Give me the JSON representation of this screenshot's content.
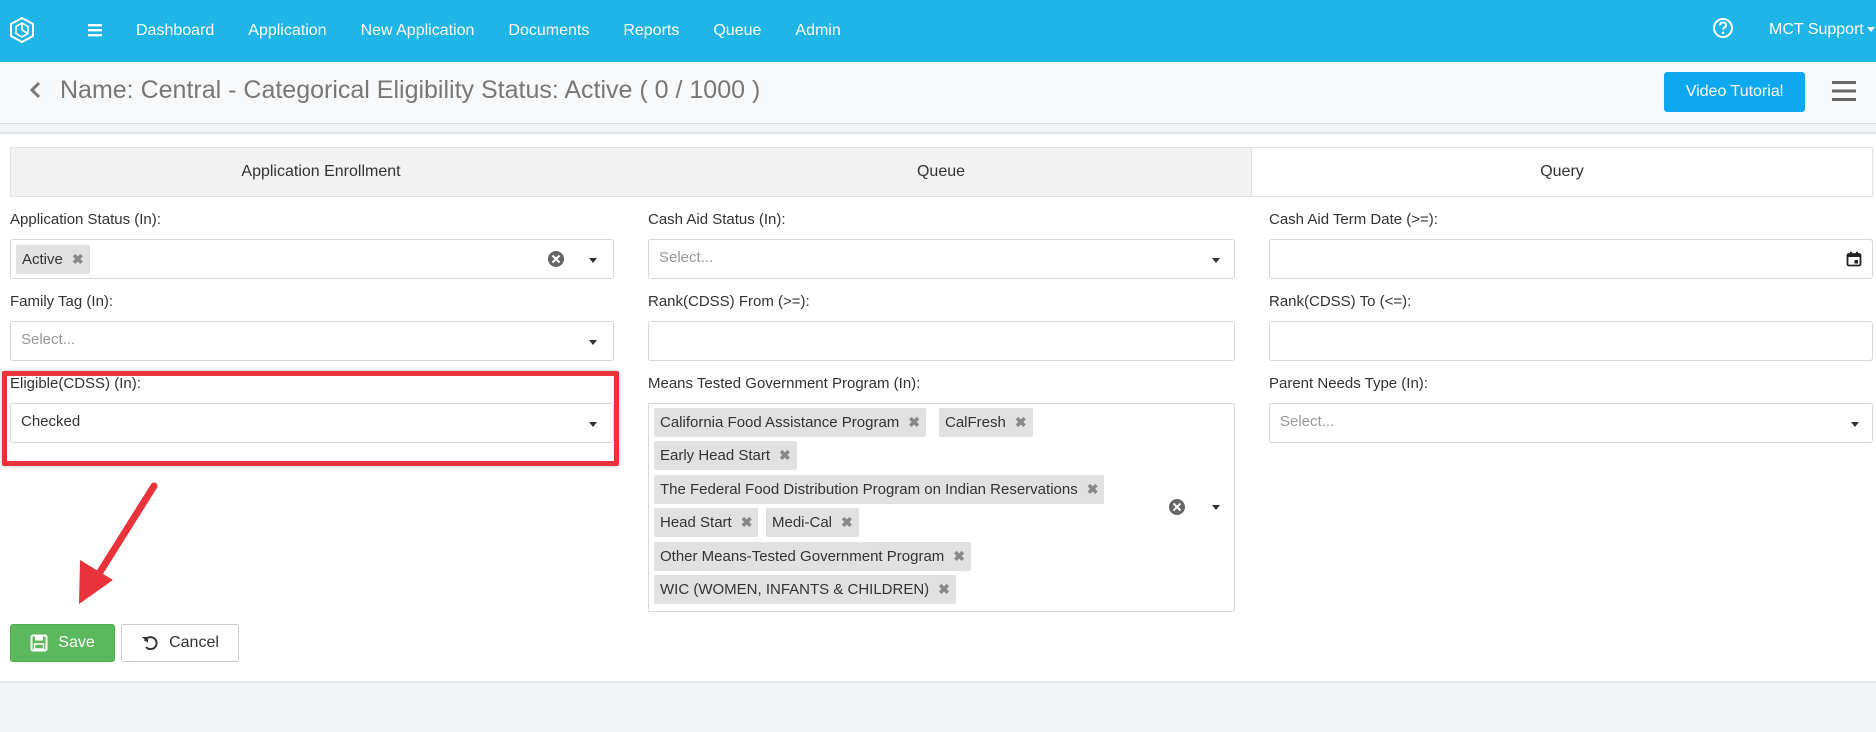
{
  "nav": {
    "links": [
      "Dashboard",
      "Application",
      "New Application",
      "Documents",
      "Reports",
      "Queue",
      "Admin"
    ],
    "user": "MCT Support"
  },
  "header": {
    "title": "Name: Central - Categorical Eligibility Status: Active ( 0 / 1000 )",
    "video_button": "Video Tutorial"
  },
  "tabs": [
    "Application Enrollment",
    "Queue",
    "Query"
  ],
  "form": {
    "application_status": {
      "label": "Application Status (In):",
      "chips": [
        "Active"
      ]
    },
    "cash_aid_status": {
      "label": "Cash Aid Status (In):",
      "placeholder": "Select..."
    },
    "cash_aid_term_date": {
      "label": "Cash Aid Term Date (>=):"
    },
    "family_tag": {
      "label": "Family Tag (In):",
      "placeholder": "Select..."
    },
    "rank_from": {
      "label": "Rank(CDSS) From (>=):"
    },
    "rank_to": {
      "label": "Rank(CDSS) To (<=):"
    },
    "eligible": {
      "label": "Eligible(CDSS) (In):",
      "value": "Checked"
    },
    "means_tested": {
      "label": "Means Tested Government Program (In):",
      "chips": [
        "California Food Assistance Program",
        "CalFresh",
        "Early Head Start",
        "The Federal Food Distribution Program on Indian Reservations",
        "Head Start",
        "Medi-Cal",
        "Other Means-Tested Government Program",
        "WIC (WOMEN, INFANTS & CHILDREN)"
      ]
    },
    "parent_needs_type": {
      "label": "Parent Needs Type (In):",
      "placeholder": "Select..."
    }
  },
  "actions": {
    "save": "Save",
    "cancel": "Cancel"
  },
  "colors": {
    "navbar": "#1fb5e6",
    "video_button": "#0ea8ef",
    "save": "#5cb85c",
    "highlight": "#e8333a"
  }
}
